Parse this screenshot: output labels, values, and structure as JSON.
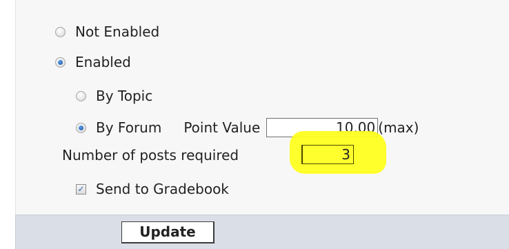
{
  "gradebook_options": {
    "not_enabled_label": "Not Enabled",
    "enabled_label": "Enabled",
    "by_topic_label": "By Topic",
    "by_forum_label": "By Forum",
    "point_value_label": "Point Value",
    "point_value": "10.00",
    "max_label": "(max)",
    "posts_required_label": "Number of posts required",
    "posts_required_value": "3",
    "send_to_gradebook_label": "Send to Gradebook",
    "send_to_gradebook_checked": true,
    "selected_mode": "Enabled",
    "selected_scope": "By Forum"
  },
  "actions": {
    "update_label": "Update"
  },
  "colors": {
    "highlight": "#ffff1a",
    "panel_bg": "#f7f7f7",
    "footer_bg": "#dadee6"
  }
}
